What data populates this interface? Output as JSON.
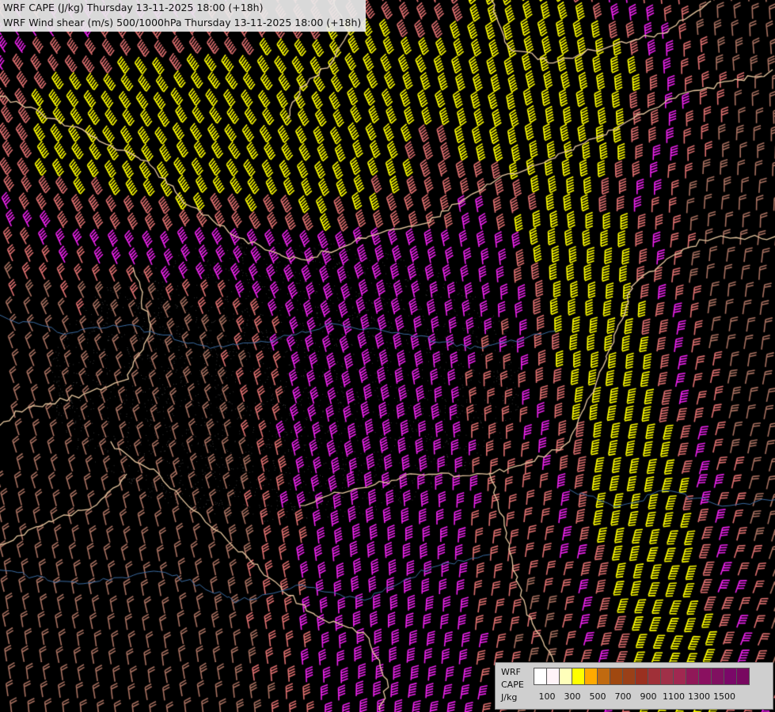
{
  "header": {
    "line1": "WRF CAPE (J/kg) Thursday 13-11-2025 18:00 (+18h)",
    "line2": "WRF Wind shear (m/s) 500/1000hPa Thursday 13-11-2025 18:00 (+18h)"
  },
  "legend": {
    "label_line1": "WRF",
    "label_line2": "CAPE",
    "label_line3": "J/kg",
    "colors": [
      "#ffffff",
      "#fff4f8",
      "#ffffbb",
      "#ffff00",
      "#ffaa00",
      "#c06a10",
      "#a04810",
      "#9a4018",
      "#9a3020",
      "#a03038",
      "#a03048",
      "#a02850",
      "#901858",
      "#8a1060",
      "#801060",
      "#7a0868",
      "#780860"
    ],
    "tick_labels": [
      "100",
      "300",
      "500",
      "700",
      "900",
      "1100",
      "1300",
      "1500"
    ]
  },
  "map": {
    "barb_colors": {
      "weak": "#a87060",
      "moderate": "#e07070",
      "strong": "#ee22ee",
      "very_strong": "#ffff00"
    }
  }
}
